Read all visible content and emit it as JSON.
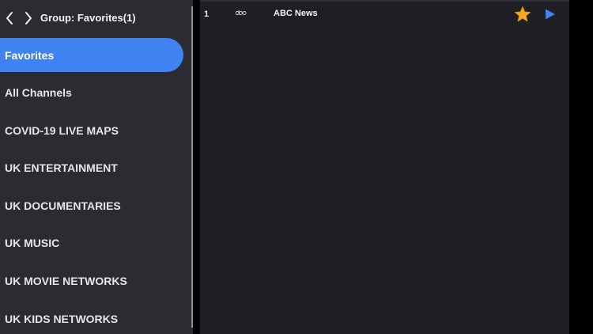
{
  "header": {
    "title": "Group: Favorites(1)",
    "back_icon": "chevron-left-icon",
    "forward_icon": "chevron-right-icon"
  },
  "groups": [
    {
      "label": "Favorites",
      "active": true
    },
    {
      "label": "All Channels",
      "active": false
    },
    {
      "label": "COVID-19 LIVE MAPS",
      "active": false
    },
    {
      "label": "UK ENTERTAINMENT",
      "active": false
    },
    {
      "label": "UK DOCUMENTARIES",
      "active": false
    },
    {
      "label": "UK MUSIC",
      "active": false
    },
    {
      "label": "UK MOVIE NETWORKS",
      "active": false
    },
    {
      "label": "UK KIDS NETWORKS",
      "active": false
    }
  ],
  "channels": [
    {
      "number": "1",
      "name": "ABC News",
      "logo_icon": "abc-logo-icon",
      "favorite_icon": "star-icon",
      "play_icon": "play-icon"
    }
  ],
  "colors": {
    "accent": "#3f82f0",
    "star": "#f5a623",
    "sidebar_bg": "#2a2c31",
    "content_bg": "#1d1f24"
  }
}
